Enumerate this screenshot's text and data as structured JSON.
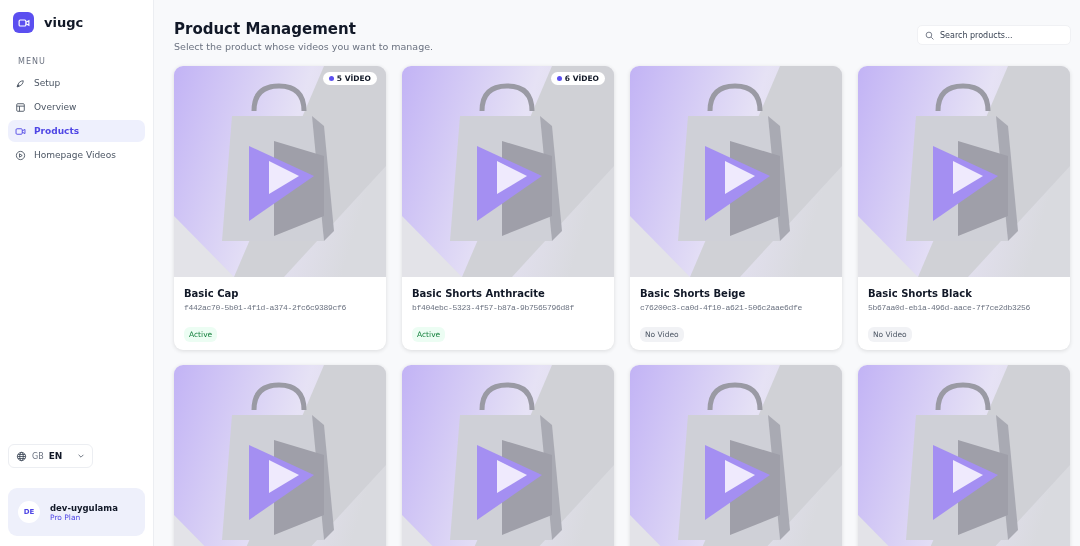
{
  "brand": {
    "name": "viugc"
  },
  "menu": {
    "heading": "MENU",
    "items": [
      {
        "label": "Setup",
        "selected": false
      },
      {
        "label": "Overview",
        "selected": false
      },
      {
        "label": "Products",
        "selected": true
      },
      {
        "label": "Homepage Videos",
        "selected": false
      }
    ]
  },
  "language": {
    "flag": "GB",
    "code": "EN"
  },
  "user": {
    "initials": "DE",
    "name": "dev-uygulama",
    "plan": "Pro Plan"
  },
  "header": {
    "title": "Product Management",
    "subtitle": "Select the product whose videos you want to manage."
  },
  "search": {
    "placeholder": "Search products..."
  },
  "products": [
    {
      "badge": "5 VİDEO",
      "name": "Basic Cap",
      "id": "f442ac70-5b01-4f1d-a374-2fc6c9389cf6",
      "status": {
        "label": "Active",
        "kind": "active"
      }
    },
    {
      "badge": "6 VİDEO",
      "name": "Basic Shorts Anthracite",
      "id": "bf404ebc-5323-4f57-b87a-9b7565796d8f",
      "status": {
        "label": "Active",
        "kind": "active"
      }
    },
    {
      "name": "Basic Shorts Beige",
      "id": "c76200c3-ca0d-4f10-a621-506c2aae6dfe",
      "status": {
        "label": "No Video",
        "kind": "none"
      }
    },
    {
      "name": "Basic Shorts Black",
      "id": "5b67aa0d-eb1a-496d-aace-7f7ce2db3256",
      "status": {
        "label": "No Video",
        "kind": "none"
      }
    },
    {
      "kind": "picture"
    },
    {
      "kind": "picture"
    },
    {
      "kind": "picture"
    },
    {
      "kind": "picture"
    }
  ]
}
